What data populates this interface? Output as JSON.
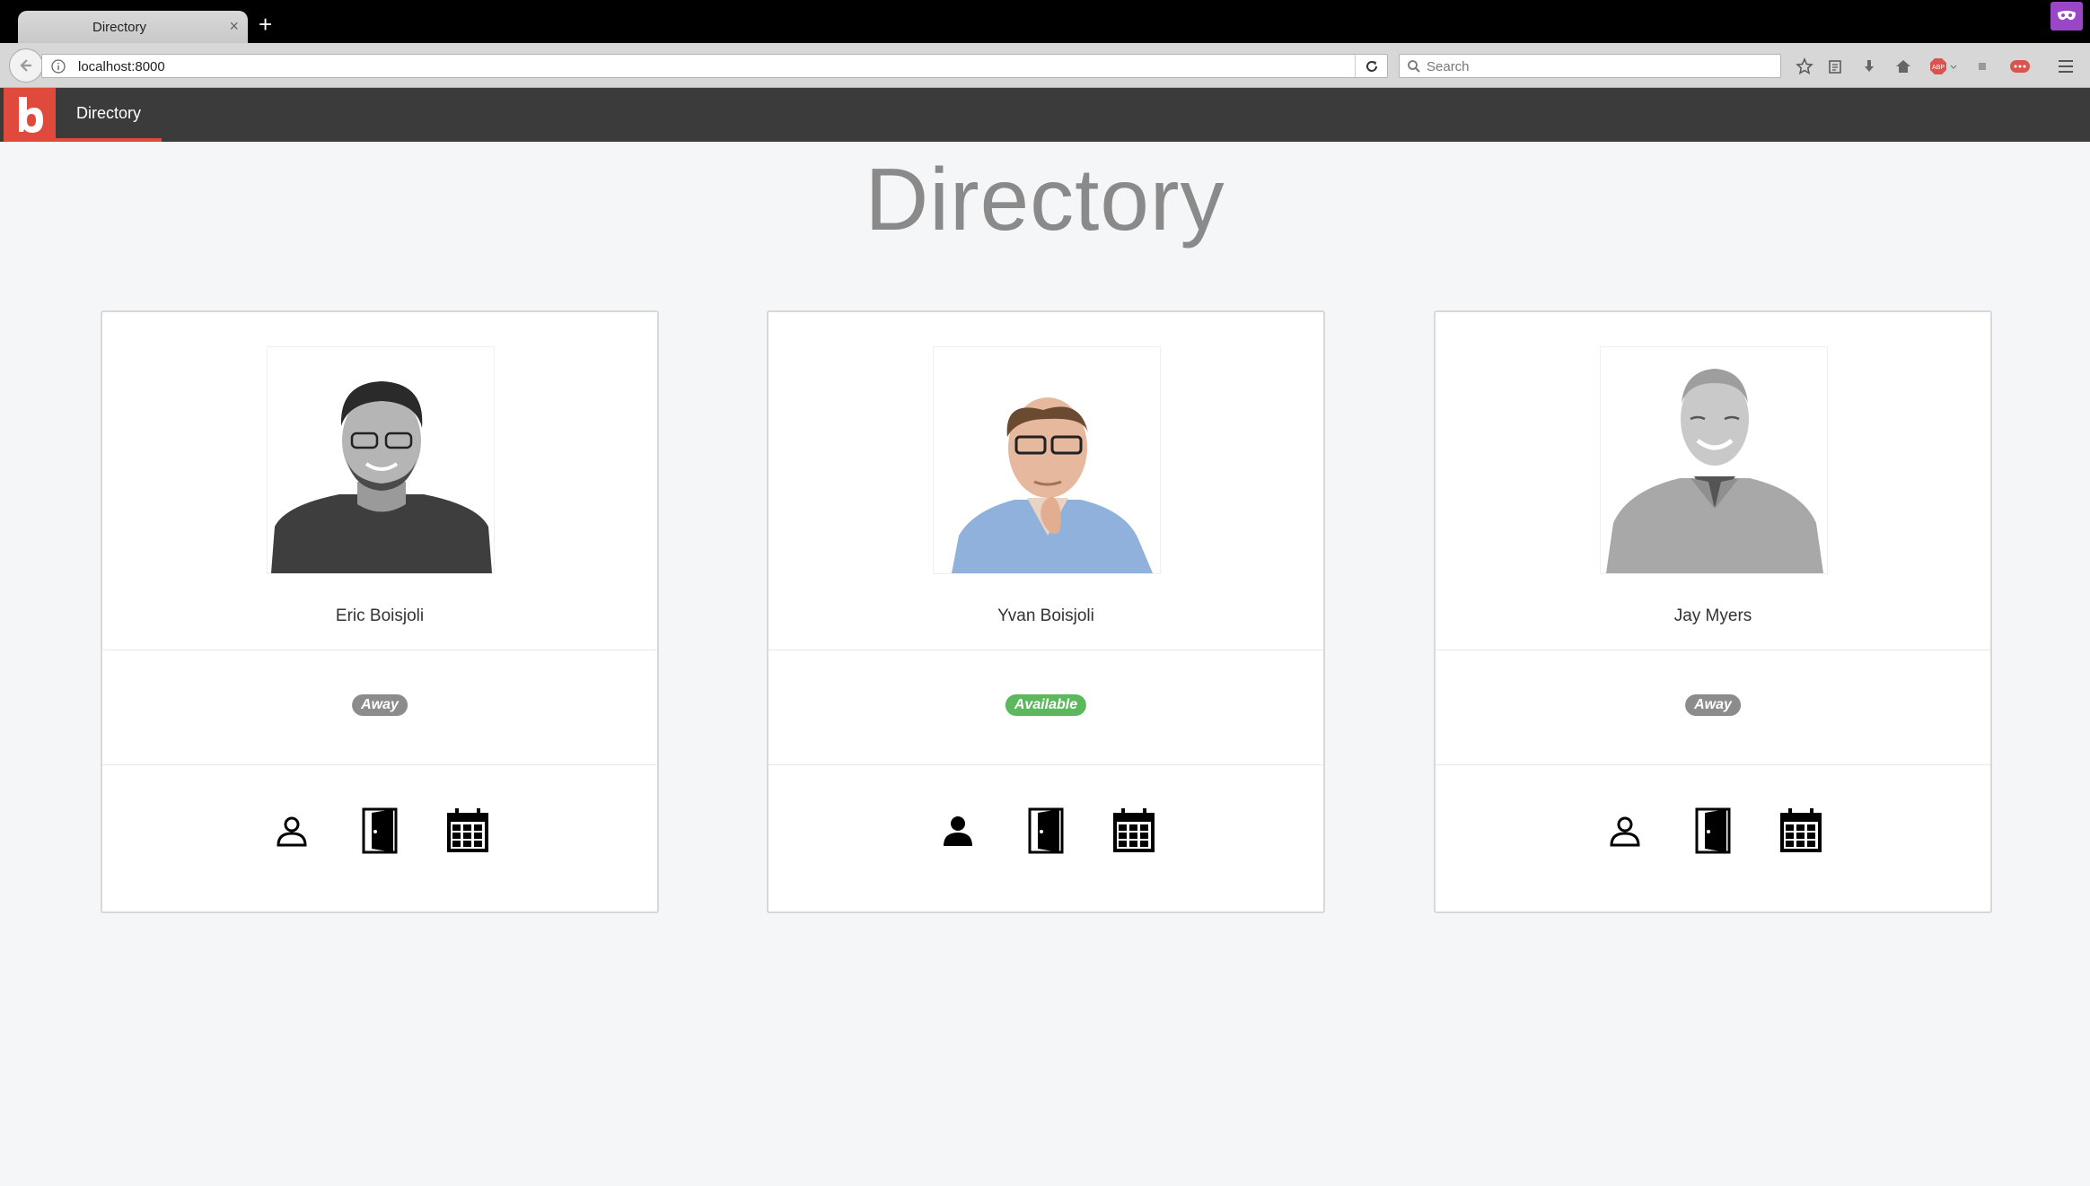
{
  "browser": {
    "tab_title": "Directory",
    "tab_close": "×",
    "new_tab": "+",
    "url": "localhost:8000",
    "search_placeholder": "Search"
  },
  "app": {
    "nav_item": "Directory"
  },
  "page": {
    "title": "Directory"
  },
  "people": [
    {
      "name": "Eric Boisjoli",
      "status": "Away",
      "status_color": "#8c8c8c"
    },
    {
      "name": "Yvan Boisjoli",
      "status": "Available",
      "status_color": "#5cb85c"
    },
    {
      "name": "Jay Myers",
      "status": "Away",
      "status_color": "#8c8c8c"
    }
  ],
  "colors": {
    "brand": "#e04a3d",
    "header": "#3b3b3b",
    "available": "#5cb85c",
    "away": "#8c8c8c"
  },
  "icons": [
    "person-icon",
    "door-icon",
    "calendar-icon"
  ]
}
